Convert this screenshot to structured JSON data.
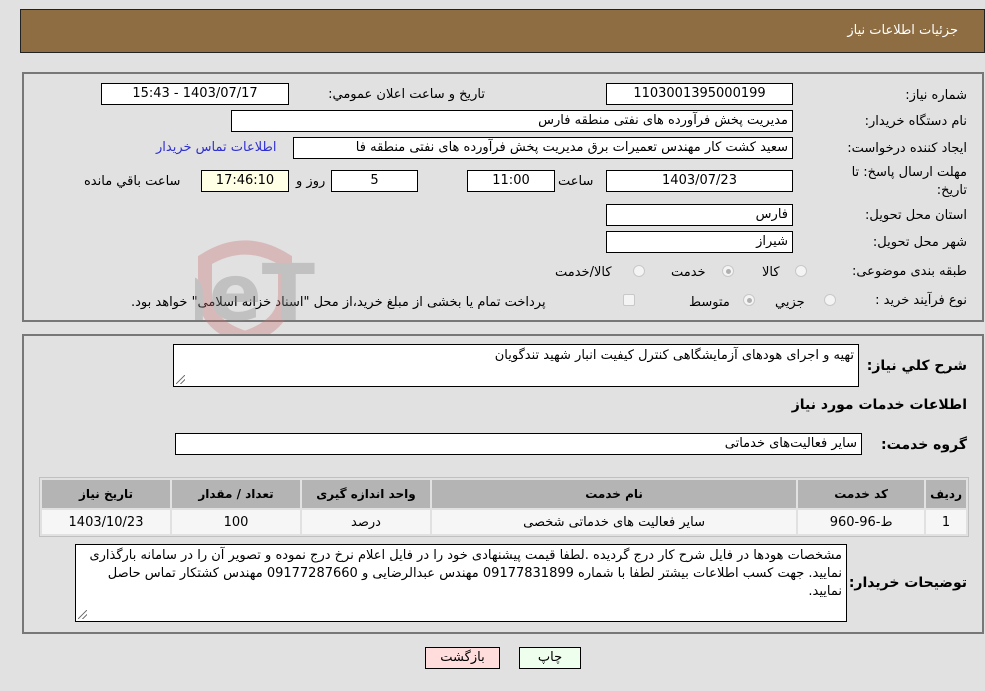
{
  "header": {
    "title": "جزئیات اطلاعات نیاز"
  },
  "details": {
    "need_number_label": "شماره نیاز:",
    "need_number": "1103001395000199",
    "announce_label": "تاریخ و ساعت اعلان عمومي:",
    "announce_value": "1403/07/17 - 15:43",
    "buyer_org_label": "نام دستگاه خریدار:",
    "buyer_org": "مدیریت پخش فرآورده های نفتی منطقه فارس",
    "creator_label": "ایجاد کننده درخواست:",
    "creator": "سعید کشت کار مهندس تعمیرات برق مدیریت پخش فرآورده های نفتی منطقه فا",
    "contact_link": "اطلاعات تماس خریدار",
    "deadline_label_1": "مهلت ارسال پاسخ: تا",
    "deadline_label_2": "تاریخ:",
    "deadline_date": "1403/07/23",
    "hour_label": "ساعت",
    "deadline_time": "11:00",
    "days_value": "5",
    "days_label": "روز و",
    "remaining_time": "17:46:10",
    "remaining_label": "ساعت باقي مانده",
    "province_label": "استان محل تحویل:",
    "province": "فارس",
    "city_label": "شهر محل تحویل:",
    "city": "شیراز",
    "category_label": "طبقه بندی موضوعی:",
    "category_options": [
      "کالا",
      "خدمت",
      "کالا/خدمت"
    ],
    "category_selected": "خدمت",
    "process_label": "نوع فرآیند خرید :",
    "process_options": [
      "جزیي",
      "متوسط"
    ],
    "process_selected": "متوسط",
    "treasury_note": "پرداخت تمام یا بخشی از مبلغ خرید،از محل \"اسناد خزانه اسلامی\" خواهد بود."
  },
  "summary": {
    "description_label": "شرح کلي نیاز:",
    "description": "تهیه و اجرای هودهای آزمایشگاهی کنترل کیفیت انبار شهید تندگویان",
    "services_title": "اطلاعات خدمات مورد نیاز",
    "service_group_label": "گروه خدمت:",
    "service_group": "سایر فعالیت‌های خدماتی"
  },
  "table": {
    "headers": [
      "ردیف",
      "کد خدمت",
      "نام خدمت",
      "واحد اندازه گیری",
      "تعداد / مقدار",
      "تاریخ نیاز"
    ],
    "rows": [
      [
        "1",
        "ط-96-960",
        "سایر فعالیت های خدماتی شخصی",
        "درصد",
        "100",
        "1403/10/23"
      ]
    ]
  },
  "buyer_notes": {
    "label": "توضیحات خریدار:",
    "text": "مشخصات هودها در فایل شرح کار درج گردیده .لطفا قیمت پیشنهادی خود را در فایل اعلام نرخ درج نموده و تصویر آن را در سامانه بارگذاری نمایید.   جهت کسب اطلاعات بیشتر لطفا با شماره 09177831899 مهندس عبدالرضایی و 09177287660 مهندس کشتکار تماس حاصل نمایید."
  },
  "buttons": {
    "print": "چاپ",
    "back": "بازگشت"
  },
  "watermark": {
    "text": "AriaTender.neT"
  },
  "colors": {
    "header_bg": "#8e6d42",
    "link": "#2f2fd0",
    "print_bg": "#eeffee",
    "back_bg": "#ffdddd"
  }
}
